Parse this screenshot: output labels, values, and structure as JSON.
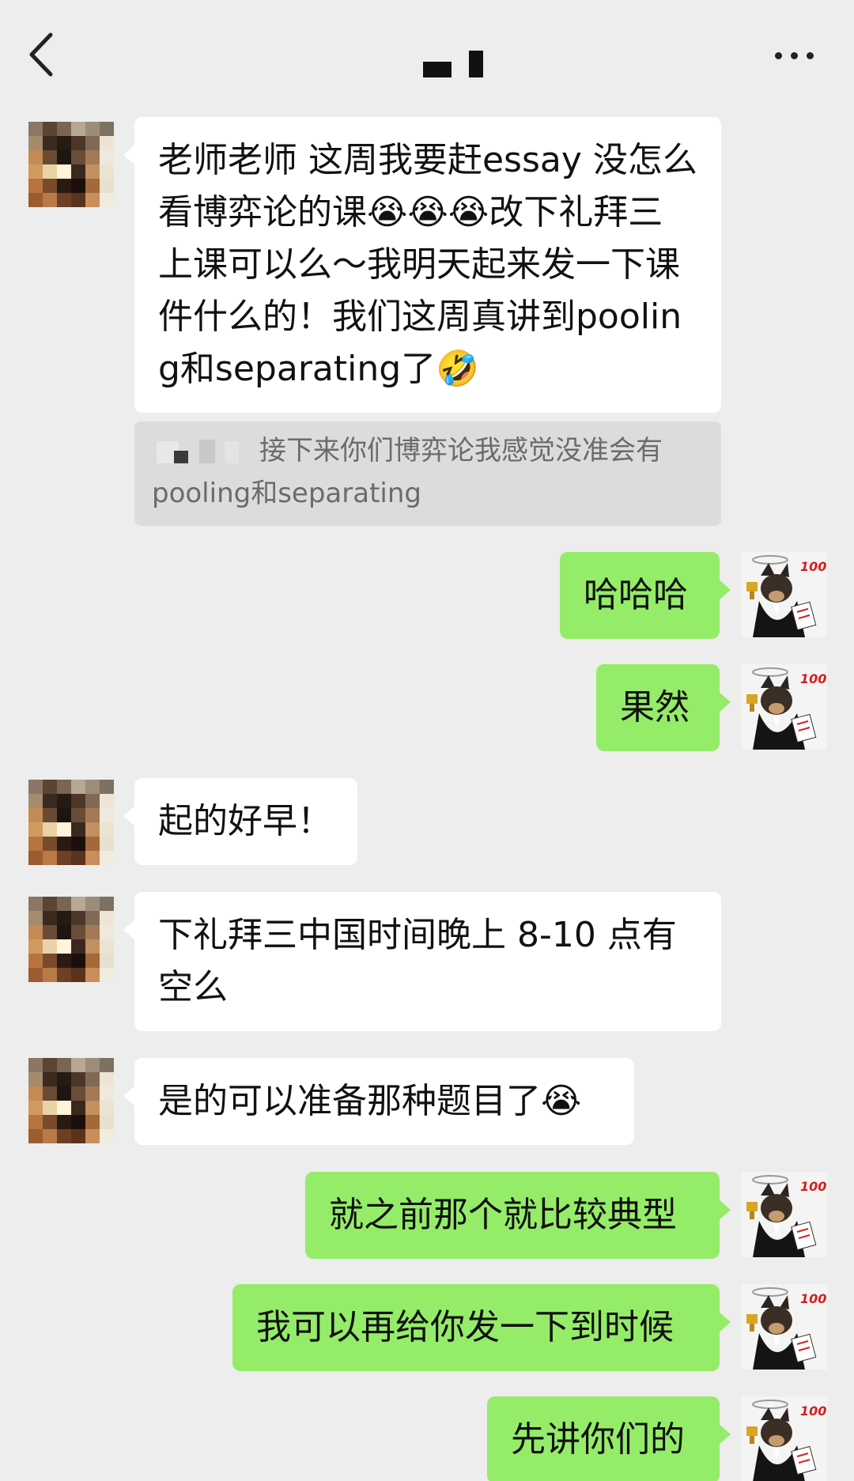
{
  "header": {
    "back_icon": "chevron-left-icon",
    "more_icon": "more-dots-icon"
  },
  "messages": [
    {
      "side": "in",
      "text": "老师老师 这周我要赶essay 没怎么看博弈论的课😭😭😭改下礼拜三上课可以么～我明天起来发一下课件什么的！我们这周真讲到pooling和separating了🤣"
    },
    {
      "side": "quote",
      "text": "接下来你们博弈论我感觉没准会有pooling和separating"
    },
    {
      "side": "out",
      "text": "哈哈哈"
    },
    {
      "side": "out",
      "text": "果然"
    },
    {
      "side": "in",
      "text": "起的好早！"
    },
    {
      "side": "in",
      "text": "下礼拜三中国时间晚上 8-10 点有空么"
    },
    {
      "side": "in",
      "text": "是的可以准备那种题目了😭"
    },
    {
      "side": "out",
      "text": "就之前那个就比较典型"
    },
    {
      "side": "out",
      "text": "我可以再给你发一下到时候"
    },
    {
      "side": "out",
      "text": "先讲你们的"
    }
  ],
  "colors": {
    "background": "#ededed",
    "bubble_in": "#ffffff",
    "bubble_out": "#95ec69"
  }
}
